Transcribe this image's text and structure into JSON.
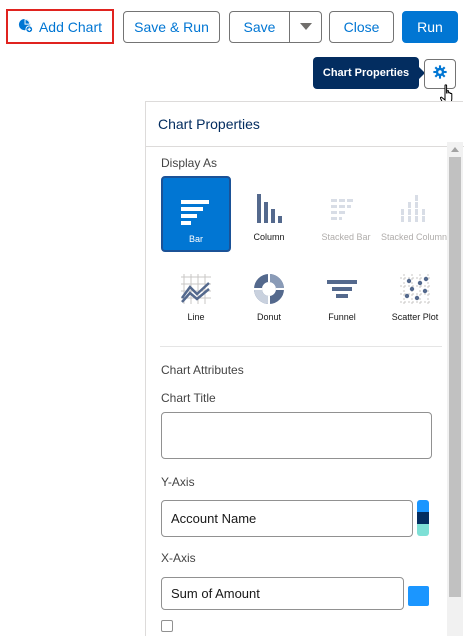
{
  "toolbar": {
    "add_chart_label": "Add Chart",
    "save_run_label": "Save & Run",
    "save_label": "Save",
    "close_label": "Close",
    "run_label": "Run"
  },
  "tooltip": {
    "text": "Chart Properties"
  },
  "panel": {
    "title": "Chart Properties",
    "display_as_label": "Display As",
    "chart_types": [
      {
        "label": "Bar",
        "icon": "bar-chart-icon",
        "state": "selected"
      },
      {
        "label": "Column",
        "icon": "column-chart-icon",
        "state": "enabled"
      },
      {
        "label": "Stacked Bar",
        "icon": "stacked-bar-chart-icon",
        "state": "disabled"
      },
      {
        "label": "Stacked Column",
        "icon": "stacked-column-chart-icon",
        "state": "disabled"
      },
      {
        "label": "Line",
        "icon": "line-chart-icon",
        "state": "enabled"
      },
      {
        "label": "Donut",
        "icon": "donut-chart-icon",
        "state": "enabled"
      },
      {
        "label": "Funnel",
        "icon": "funnel-chart-icon",
        "state": "enabled"
      },
      {
        "label": "Scatter Plot",
        "icon": "scatter-plot-icon",
        "state": "enabled"
      }
    ],
    "chart_attributes_label": "Chart Attributes",
    "chart_title_label": "Chart Title",
    "chart_title_value": "",
    "y_axis_label": "Y-Axis",
    "y_axis_value": "Account Name",
    "x_axis_label": "X-Axis",
    "x_axis_value": "Sum of Amount"
  },
  "colors": {
    "accent": "#0176d3",
    "tooltip_bg": "#032d60",
    "highlight_border": "#e0231f",
    "y_swatches": [
      "#1b96ff",
      "#032d60",
      "#7ee0d6"
    ],
    "x_swatch": "#1b96ff"
  }
}
